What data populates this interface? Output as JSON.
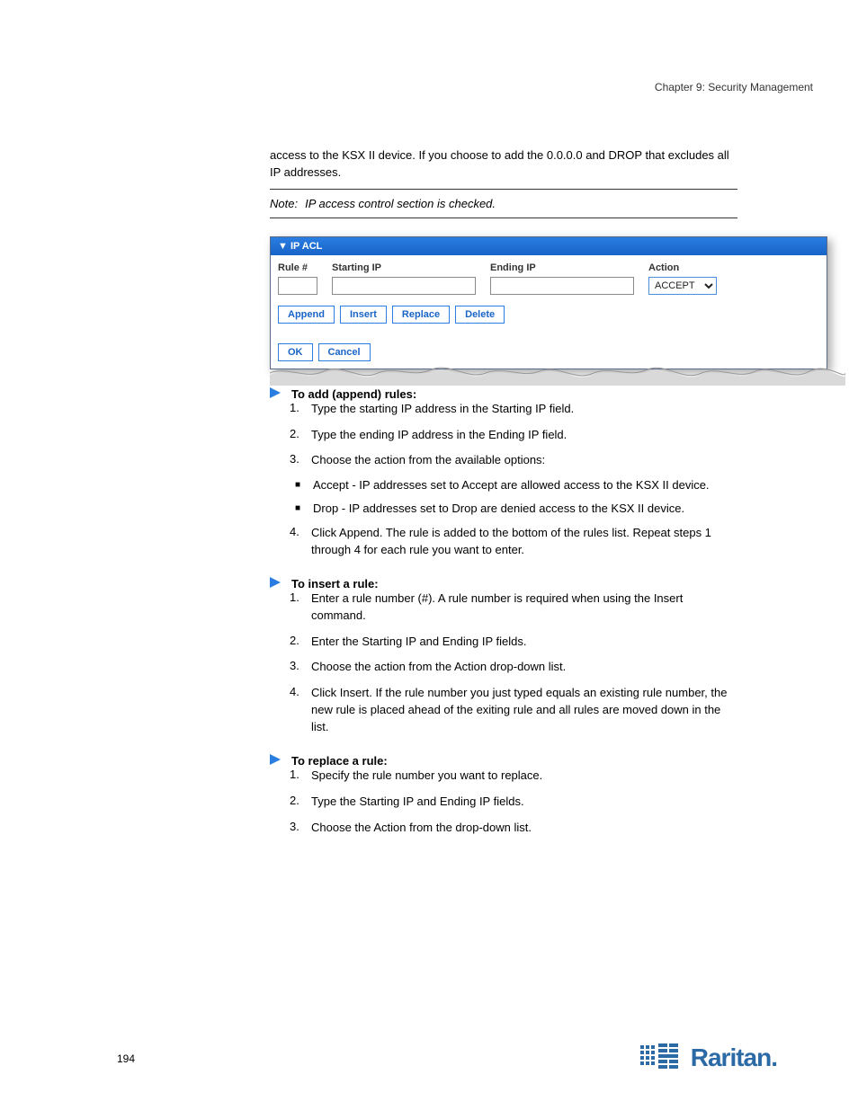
{
  "header": "Chapter 9: Security Management",
  "intro_para": "access to the KSX II device. If you choose to add the 0.0.0.0 and DROP that excludes all IP addresses.",
  "note_label": "Note:",
  "note_text": "IP access control section is checked.",
  "screenshot": {
    "panel_title": "▼ IP ACL",
    "col_rule": "Rule #",
    "col_start": "Starting IP",
    "col_end": "Ending IP",
    "col_action": "Action",
    "select_value": "ACCEPT",
    "btn_append": "Append",
    "btn_insert": "Insert",
    "btn_replace": "Replace",
    "btn_delete": "Delete",
    "btn_ok": "OK",
    "btn_cancel": "Cancel"
  },
  "sections": {
    "append": {
      "title": "To add (append) rules:",
      "steps": [
        "Type the starting IP address in the Starting IP field.",
        "Type the ending IP address in the Ending IP field.",
        "Choose the action from the available options:"
      ],
      "bullets": [
        "Accept - IP addresses set to Accept are allowed access to the KSX II device.",
        "Drop - IP addresses set to Drop are denied access to the KSX II device."
      ],
      "steps_after": [
        "Click Append. The rule is added to the bottom of the rules list. Repeat steps 1 through 4 for each rule you want to enter."
      ]
    },
    "insert": {
      "title": "To insert a rule:",
      "steps": [
        "Enter a rule number (#). A rule number is required when using the Insert command.",
        "Enter the Starting IP and Ending IP fields.",
        "Choose the action from the Action drop-down list.",
        "Click Insert. If the rule number you just typed equals an existing rule number, the new rule is placed ahead of the exiting rule and all rules are moved down in the list."
      ]
    },
    "replace": {
      "title": "To replace a rule:",
      "steps": [
        "Specify the rule number you want to replace.",
        "Type the Starting IP and Ending IP fields.",
        "Choose the Action from the drop-down list."
      ]
    }
  },
  "page_number": "194",
  "brand": "Raritan."
}
